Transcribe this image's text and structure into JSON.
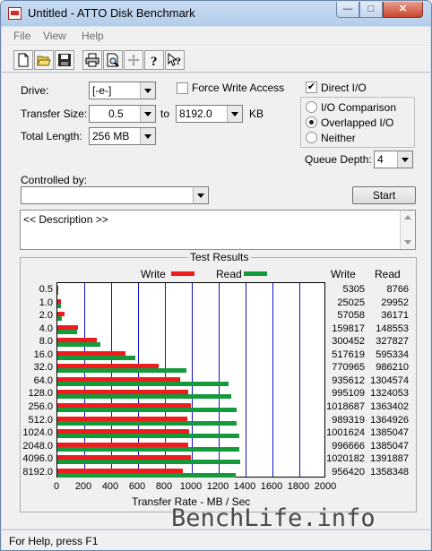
{
  "window": {
    "title": "Untitled - ATTO Disk Benchmark"
  },
  "titlebar_buttons": {
    "minimize": "—",
    "maximize": "□",
    "close": "✕"
  },
  "menu": [
    "File",
    "View",
    "Help"
  ],
  "toolbar": [
    "new-file-icon",
    "open-folder-icon",
    "save-icon",
    "print-icon",
    "print-preview-icon",
    "move-icon",
    "help-icon",
    "context-help-icon"
  ],
  "settings": {
    "drive_label": "Drive:",
    "drive_value": "[-e-]",
    "force_write_label": "Force Write Access",
    "force_write_checked": false,
    "direct_io_label": "Direct I/O",
    "direct_io_checked": true,
    "transfer_size_label": "Transfer Size:",
    "transfer_from": "0.5",
    "to_label": "to",
    "transfer_to": "8192.0",
    "kb_label": "KB",
    "total_length_label": "Total Length:",
    "total_length_value": "256 MB",
    "io_comparison_label": "I/O Comparison",
    "overlapped_io_label": "Overlapped I/O",
    "neither_label": "Neither",
    "io_mode_selected": "Overlapped I/O",
    "queue_depth_label": "Queue Depth:",
    "queue_depth_value": "4",
    "controlled_by_label": "Controlled by:",
    "controlled_by_value": "",
    "start_label": "Start",
    "description_text": "<< Description >>"
  },
  "results": {
    "title": "Test Results",
    "legend_write": "Write",
    "legend_read": "Read",
    "col_write": "Write",
    "col_read": "Read",
    "xlabel": "Transfer Rate - MB / Sec"
  },
  "status": {
    "text": "For Help, press F1"
  },
  "watermark": "BenchLife.info",
  "colors": {
    "write": "#ee1c1c",
    "read": "#149a3a",
    "grid": "#1010c8"
  },
  "chart_data": {
    "type": "bar",
    "orientation": "horizontal",
    "categories": [
      "0.5",
      "1.0",
      "2.0",
      "4.0",
      "8.0",
      "16.0",
      "32.0",
      "64.0",
      "128.0",
      "256.0",
      "512.0",
      "1024.0",
      "2048.0",
      "4096.0",
      "8192.0"
    ],
    "series": [
      {
        "name": "Write",
        "values": [
          5.2,
          24.4,
          55.7,
          156.1,
          293.4,
          505.6,
          752.9,
          913.7,
          971.8,
          995.4,
          966.1,
          978.2,
          973.6,
          996.3,
          934.0
        ]
      },
      {
        "name": "Read",
        "values": [
          8.6,
          29.3,
          35.3,
          145.1,
          320.1,
          581.4,
          963.1,
          1274.0,
          1293.0,
          1331.4,
          1332.9,
          1352.6,
          1352.6,
          1359.3,
          1326.5
        ]
      }
    ],
    "table_write": [
      "5305",
      "25025",
      "57058",
      "159817",
      "300452",
      "517619",
      "770965",
      "935612",
      "995109",
      "1018687",
      "989319",
      "1001624",
      "996666",
      "1020182",
      "956420"
    ],
    "table_read": [
      "8766",
      "29952",
      "36171",
      "148553",
      "327827",
      "595334",
      "986210",
      "1304574",
      "1324053",
      "1363402",
      "1364926",
      "1385047",
      "1385047",
      "1391887",
      "1358348"
    ],
    "xticks": [
      "0",
      "200",
      "400",
      "600",
      "800",
      "1000",
      "1200",
      "1400",
      "1600",
      "1800",
      "2000"
    ],
    "xlim": [
      0,
      2000
    ],
    "xlabel": "Transfer Rate - MB / Sec",
    "legend": "top",
    "grid": true
  }
}
